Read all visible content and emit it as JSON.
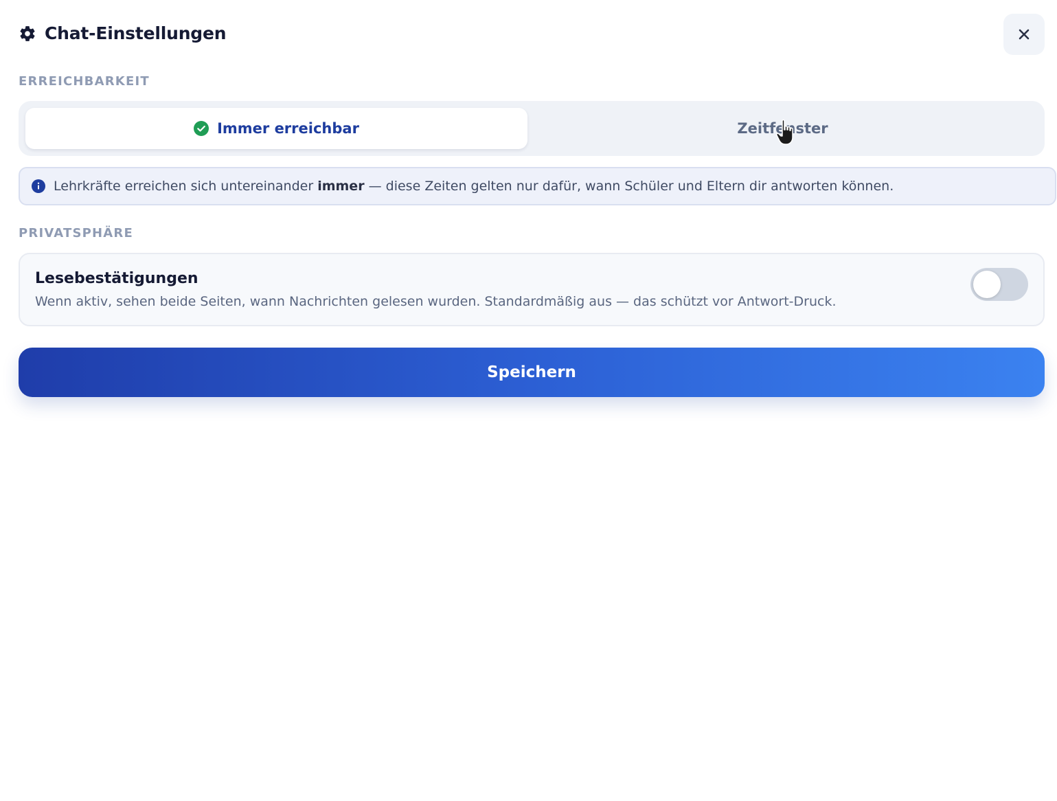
{
  "header": {
    "title": "Chat-Einstellungen",
    "icon": "gear-icon",
    "close_icon": "close-icon"
  },
  "reachability": {
    "section_label": "ERREICHBARKEIT",
    "options": [
      {
        "label": "Immer erreichbar",
        "selected": true,
        "icon": "check-circle-icon"
      },
      {
        "label": "Zeitfenster",
        "selected": false
      }
    ],
    "info": {
      "icon": "info-icon",
      "text_before": "Lehrkräfte erreichen sich untereinander ",
      "text_bold": "immer",
      "text_after": " — diese Zeiten gelten nur dafür, wann Schüler und Eltern dir antworten können."
    }
  },
  "privacy": {
    "section_label": "PRIVATSPHÄRE",
    "read_receipts": {
      "title": "Lesebestätigungen",
      "description": "Wenn aktiv, sehen beide Seiten, wann Nachrichten gelesen wurden. Standardmäßig aus — das schützt vor Antwort-Druck.",
      "enabled": false
    }
  },
  "actions": {
    "save_label": "Speichern"
  },
  "colors": {
    "accent": "#1e3d9f",
    "success": "#1f9d55",
    "button_gradient_start": "#1f3daa",
    "button_gradient_end": "#3b82f0"
  }
}
